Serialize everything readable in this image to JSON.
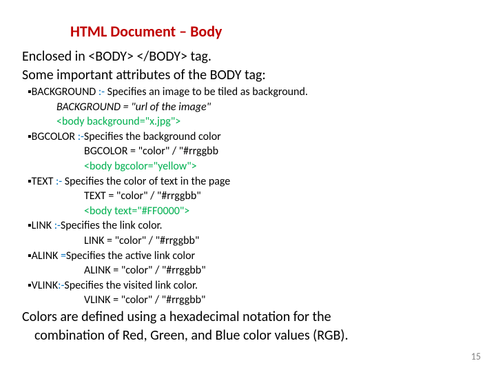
{
  "title": "HTML Document – Body",
  "l1": "Enclosed in <BODY> </BODY> tag.",
  "l2": "Some important attributes of the BODY  tag:",
  "bg_head_a": "BACKGROUND ",
  "bg_head_b": ":- ",
  "bg_head_c": "Specifies an image to be tiled as background.",
  "bg_syntax": "BACKGROUND = \"url of the image\"",
  "bg_code": "<body background=\"x.jpg\">",
  "bgc_head_a": "BGCOLOR ",
  "bgc_head_b": ":-",
  "bgc_head_c": "Specifies the background color",
  "bgc_syntax": "BGCOLOR = \"color\" / \"#rrggbb",
  "bgc_code": "<body bgcolor=\"yellow\">",
  "txt_head_a": "TEXT ",
  "txt_head_b": ":- ",
  "txt_head_c": "Specifies the color of text  in the page",
  "txt_syntax": "TEXT = \"color\" / \"#rrggbb\"",
  "txt_code": "<body text=\"#FF0000\">",
  "link_head_a": "LINK ",
  "link_head_b": ":-",
  "link_head_c": "Specifies the link color.",
  "link_syntax": "LINK = \"color\" / \"#rrggbb\"",
  "alink_head_a": "ALINK ",
  "alink_head_b": "=",
  "alink_head_c": "Specifies the active link color",
  "alink_syntax": "ALINK = \"color\" / \"#rrggbb\"",
  "vlink_head_a": "VLINK",
  "vlink_head_b": ":-",
  "vlink_head_c": "Specifies the visited link color.",
  "vlink_syntax": "VLINK = \"color\" / \"#rrggbb\"",
  "l3a": "Colors are defined using a hexadecimal notation for the",
  "l3b": "combination of Red, Green, and Blue color values (RGB).",
  "pagenum": "15"
}
